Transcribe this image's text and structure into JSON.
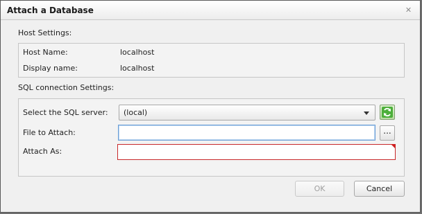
{
  "dialog": {
    "title": "Attach a Database",
    "close_glyph": "✕"
  },
  "host_settings": {
    "label": "Host Settings:",
    "host_name_label": "Host Name:",
    "host_name_value": "localhost",
    "display_name_label": "Display name:",
    "display_name_value": "localhost"
  },
  "sql_settings": {
    "label": "SQL connection Settings:",
    "server_label": "Select the SQL server:",
    "server_value": "(local)",
    "file_label": "File to Attach:",
    "file_value": "",
    "attach_as_label": "Attach As:",
    "attach_as_value": "",
    "browse_label": "..."
  },
  "buttons": {
    "ok": "OK",
    "cancel": "Cancel"
  },
  "icons": {
    "refresh": "refresh-icon",
    "close": "close-icon",
    "dropdown": "chevron-down-icon"
  },
  "colors": {
    "error_border": "#c8282a",
    "refresh_green": "#3a9a2a",
    "focus_border": "#6b9ed6"
  }
}
